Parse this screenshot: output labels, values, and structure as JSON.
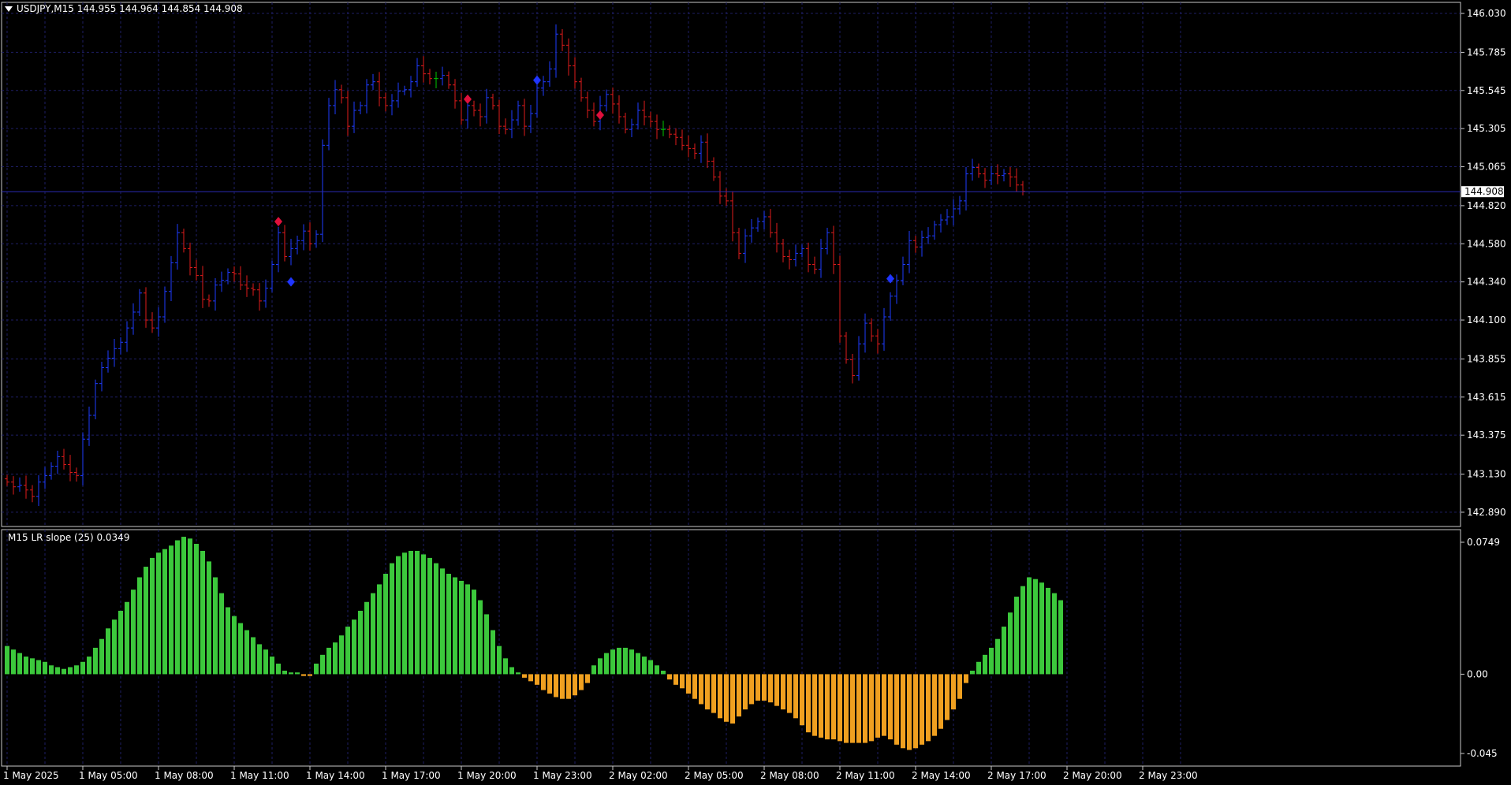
{
  "main_chart": {
    "header": "USDJPY,M15  144.955 144.964 144.854 144.908",
    "current_price_label": "144.908",
    "colors": {
      "background": "#000000",
      "grid": "#1e1e64",
      "frame": "#c8c8c8",
      "bull": "#1e3cff",
      "bear": "#e01b1b",
      "doji": "#00c800",
      "signal_up": "#1f35ff",
      "signal_down": "#e0103c",
      "text": "#ffffff"
    }
  },
  "indicator": {
    "title": "M15 LR slope (25) 0.0349",
    "colors": {
      "positive": "#3cc83c",
      "negative": "#f0a020"
    }
  },
  "x_axis_labels": [
    "1 May 2025",
    "1 May 05:00",
    "1 May 08:00",
    "1 May 11:00",
    "1 May 14:00",
    "1 May 17:00",
    "1 May 20:00",
    "1 May 23:00",
    "2 May 02:00",
    "2 May 05:00",
    "2 May 08:00",
    "2 May 11:00",
    "2 May 14:00",
    "2 May 17:00",
    "2 May 20:00",
    "2 May 23:00"
  ],
  "chart_data": [
    {
      "type": "candlestick",
      "symbol": "USDJPY",
      "timeframe": "M15",
      "y_tick_labels": [
        "146.030",
        "145.785",
        "145.545",
        "145.305",
        "145.065",
        "144.820",
        "144.580",
        "144.340",
        "144.100",
        "143.855",
        "143.615",
        "143.375",
        "143.130",
        "142.890"
      ],
      "ylim": [
        142.84,
        146.06
      ],
      "bars_per_label": 12,
      "close": [
        143.08,
        143.05,
        143.06,
        143.03,
        142.99,
        143.08,
        143.12,
        143.18,
        143.24,
        143.19,
        143.14,
        143.12,
        143.35,
        143.5,
        143.7,
        143.8,
        143.86,
        143.92,
        143.96,
        144.05,
        144.15,
        144.27,
        144.1,
        144.05,
        144.12,
        144.28,
        144.46,
        144.65,
        144.55,
        144.43,
        144.38,
        144.23,
        144.22,
        144.32,
        144.35,
        144.4,
        144.39,
        144.32,
        144.3,
        144.29,
        144.22,
        144.3,
        144.45,
        144.65,
        144.5,
        144.55,
        144.6,
        144.66,
        144.58,
        144.64,
        145.2,
        145.45,
        145.55,
        145.5,
        145.32,
        145.42,
        145.45,
        145.58,
        145.6,
        145.5,
        145.45,
        145.48,
        145.54,
        145.55,
        145.6,
        145.7,
        145.65,
        145.62,
        145.62,
        145.64,
        145.58,
        145.48,
        145.36,
        145.45,
        145.42,
        145.38,
        145.5,
        145.45,
        145.32,
        145.3,
        145.36,
        145.45,
        145.32,
        145.4,
        145.56,
        145.6,
        145.68,
        145.9,
        145.83,
        145.7,
        145.6,
        145.5,
        145.42,
        145.35,
        145.45,
        145.52,
        145.46,
        145.38,
        145.3,
        145.33,
        145.42,
        145.38,
        145.35,
        145.3,
        145.3,
        145.27,
        145.25,
        145.2,
        145.18,
        145.15,
        145.22,
        145.1,
        145.0,
        144.88,
        144.85,
        144.65,
        144.52,
        144.63,
        144.68,
        144.72,
        144.75,
        144.65,
        144.58,
        144.5,
        144.48,
        144.52,
        144.55,
        144.45,
        144.42,
        144.55,
        144.65,
        144.45,
        144.0,
        143.85,
        143.75,
        143.95,
        144.08,
        144.0,
        143.95,
        144.12,
        144.25,
        144.35,
        144.45,
        144.6,
        144.56,
        144.62,
        144.63,
        144.7,
        144.73,
        144.75,
        144.8,
        144.85,
        145.02,
        145.06,
        145.02,
        144.98,
        145.02,
        145.01,
        145.02,
        145.0,
        144.95,
        144.91
      ],
      "signals": [
        {
          "bar": 43,
          "direction": "down",
          "price": 144.72
        },
        {
          "bar": 45,
          "direction": "up",
          "price": 144.34
        },
        {
          "bar": 73,
          "direction": "down",
          "price": 145.49
        },
        {
          "bar": 84,
          "direction": "up",
          "price": 145.61
        },
        {
          "bar": 94,
          "direction": "down",
          "price": 145.39
        },
        {
          "bar": 140,
          "direction": "up",
          "price": 144.36
        }
      ]
    },
    {
      "type": "bar",
      "series_name": "M15 LR slope (25)",
      "y_tick_labels": [
        "0.0749",
        "0.00",
        "-0.045"
      ],
      "ylim": [
        -0.045,
        0.0749
      ],
      "values": [
        0.016,
        0.014,
        0.012,
        0.01,
        0.009,
        0.008,
        0.007,
        0.005,
        0.004,
        0.003,
        0.004,
        0.005,
        0.007,
        0.01,
        0.015,
        0.02,
        0.026,
        0.031,
        0.036,
        0.041,
        0.048,
        0.055,
        0.061,
        0.066,
        0.069,
        0.071,
        0.073,
        0.076,
        0.078,
        0.077,
        0.074,
        0.07,
        0.064,
        0.055,
        0.046,
        0.038,
        0.033,
        0.029,
        0.025,
        0.021,
        0.017,
        0.014,
        0.01,
        0.006,
        0.002,
        0.001,
        0.001,
        -0.001,
        -0.001,
        0.006,
        0.011,
        0.015,
        0.018,
        0.022,
        0.027,
        0.031,
        0.036,
        0.041,
        0.046,
        0.051,
        0.057,
        0.063,
        0.067,
        0.069,
        0.07,
        0.07,
        0.068,
        0.066,
        0.063,
        0.06,
        0.057,
        0.055,
        0.053,
        0.051,
        0.048,
        0.042,
        0.034,
        0.025,
        0.016,
        0.009,
        0.004,
        0.001,
        -0.002,
        -0.004,
        -0.006,
        -0.009,
        -0.011,
        -0.013,
        -0.014,
        -0.014,
        -0.012,
        -0.009,
        -0.005,
        0.005,
        0.009,
        0.012,
        0.014,
        0.015,
        0.015,
        0.014,
        0.012,
        0.01,
        0.008,
        0.005,
        0.002,
        -0.003,
        -0.006,
        -0.008,
        -0.011,
        -0.014,
        -0.017,
        -0.02,
        -0.022,
        -0.025,
        -0.027,
        -0.028,
        -0.024,
        -0.02,
        -0.017,
        -0.015,
        -0.015,
        -0.016,
        -0.018,
        -0.02,
        -0.022,
        -0.025,
        -0.029,
        -0.033,
        -0.035,
        -0.036,
        -0.037,
        -0.037,
        -0.038,
        -0.039,
        -0.039,
        -0.039,
        -0.039,
        -0.038,
        -0.036,
        -0.035,
        -0.037,
        -0.04,
        -0.042,
        -0.043,
        -0.042,
        -0.04,
        -0.038,
        -0.035,
        -0.031,
        -0.026,
        -0.02,
        -0.014,
        -0.005,
        0.002,
        0.007,
        0.011,
        0.015,
        0.02,
        0.027,
        0.035,
        0.044,
        0.05,
        0.055,
        0.054,
        0.052,
        0.049,
        0.046,
        0.042
      ]
    }
  ]
}
